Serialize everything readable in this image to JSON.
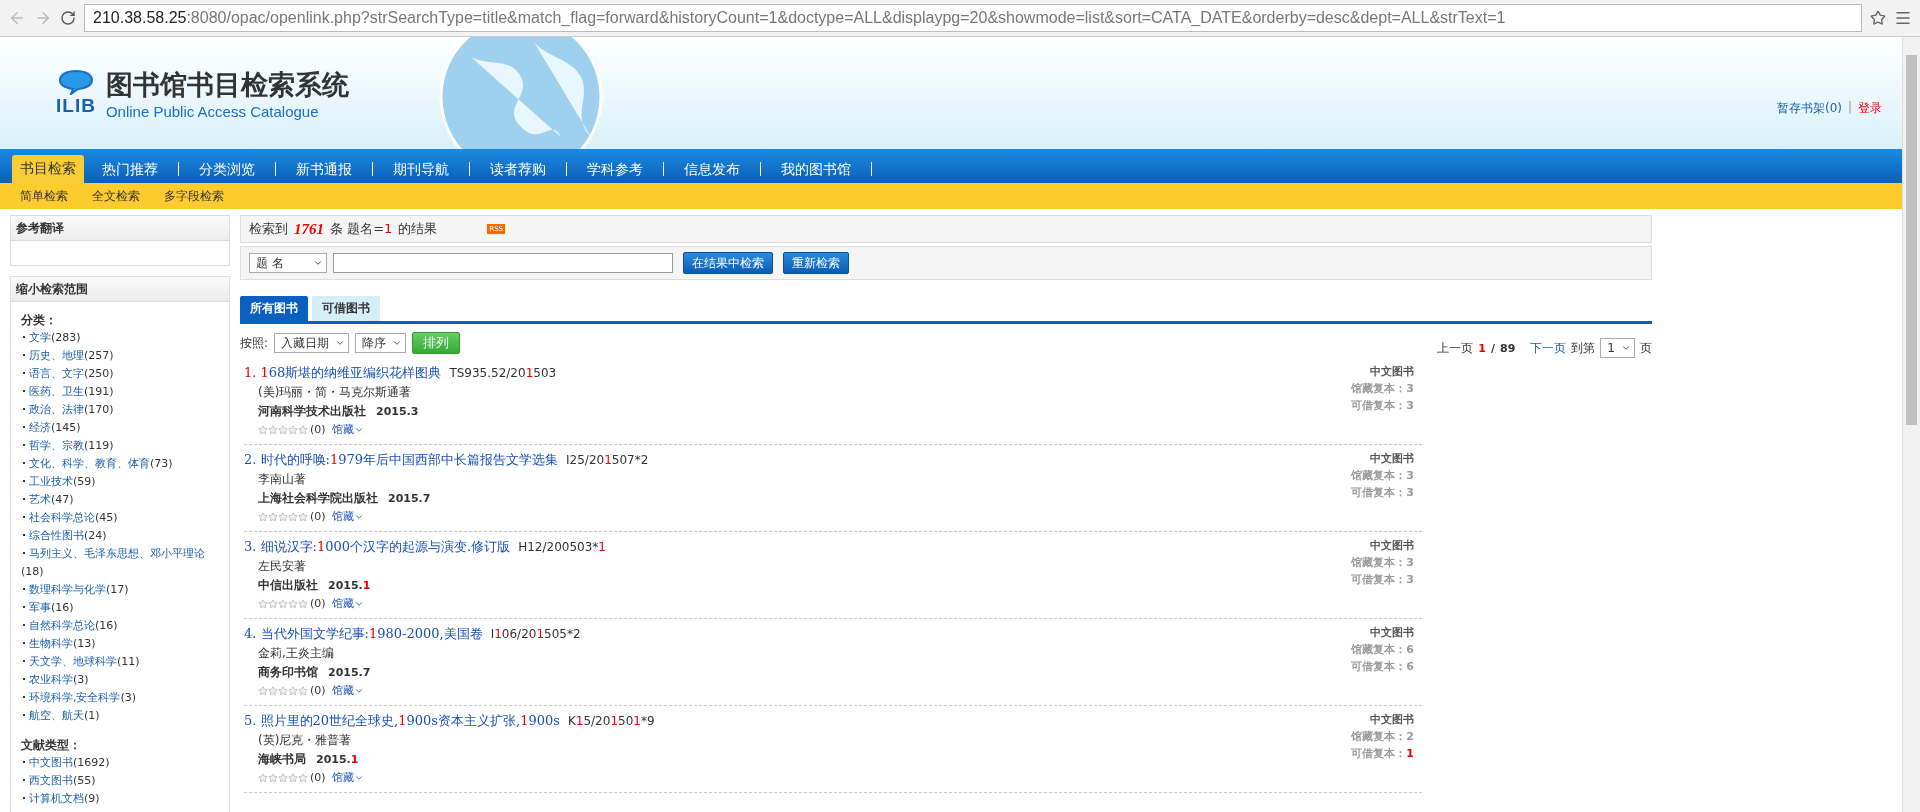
{
  "browser": {
    "url_host": "210.38.58.25",
    "url_path": ":8080/opac/openlink.php?strSearchType=title&match_flag=forward&historyCount=1&doctype=ALL&displaypg=20&showmode=list&sort=CATA_DATE&orderby=desc&dept=ALL&strText=1"
  },
  "header": {
    "logo_text": "ILIB",
    "title": "图书馆书目检索系统",
    "subtitle": "Online Public Access Catalogue",
    "shelf_link": "暂存书架(0)",
    "separator": "|",
    "login_link": "登录"
  },
  "nav": [
    {
      "label": "书目检索",
      "selected": true
    },
    {
      "label": "热门推荐",
      "selected": false
    },
    {
      "label": "分类浏览",
      "selected": false
    },
    {
      "label": "新书通报",
      "selected": false
    },
    {
      "label": "期刊导航",
      "selected": false
    },
    {
      "label": "读者荐购",
      "selected": false
    },
    {
      "label": "学科参考",
      "selected": false
    },
    {
      "label": "信息发布",
      "selected": false
    },
    {
      "label": "我的图书馆",
      "selected": false
    }
  ],
  "subnav": [
    "简单检索",
    "全文检索",
    "多字段检索"
  ],
  "sidebar": {
    "translate_title": "参考翻译",
    "refine_title": "缩小检索范围",
    "groups": [
      {
        "title": "分类：",
        "items": [
          {
            "label": "文学",
            "count": "(283)"
          },
          {
            "label": "历史、地理",
            "count": "(257)"
          },
          {
            "label": "语言、文字",
            "count": "(250)"
          },
          {
            "label": "医药、卫生",
            "count": "(191)"
          },
          {
            "label": "政治、法律",
            "count": "(170)"
          },
          {
            "label": "经济",
            "count": "(145)"
          },
          {
            "label": "哲学、宗教",
            "count": "(119)"
          },
          {
            "label": "文化、科学、教育、体育",
            "count": "(73)"
          },
          {
            "label": "工业技术",
            "count": "(59)"
          },
          {
            "label": "艺术",
            "count": "(47)"
          },
          {
            "label": "社会科学总论",
            "count": "(45)"
          },
          {
            "label": "综合性图书",
            "count": "(24)"
          },
          {
            "label": "马列主义、毛泽东思想、邓小平理论",
            "count": "(18)"
          },
          {
            "label": "数理科学与化学",
            "count": "(17)"
          },
          {
            "label": "军事",
            "count": "(16)"
          },
          {
            "label": "自然科学总论",
            "count": "(16)"
          },
          {
            "label": "生物科学",
            "count": "(13)"
          },
          {
            "label": "天文学、地球科学",
            "count": "(11)"
          },
          {
            "label": "农业科学",
            "count": "(3)"
          },
          {
            "label": "环境科学,安全科学",
            "count": "(3)"
          },
          {
            "label": "航空、航天",
            "count": "(1)"
          }
        ]
      },
      {
        "title": "文献类型：",
        "items": [
          {
            "label": "中文图书",
            "count": "(1692)"
          },
          {
            "label": "西文图书",
            "count": "(55)"
          },
          {
            "label": "计算机文档",
            "count": "(9)"
          }
        ]
      }
    ]
  },
  "summary": {
    "prefix": "检索到",
    "count": "1761",
    "middle": "条 题名=",
    "term": "1",
    "suffix": "的结果",
    "rss": "RSS"
  },
  "search": {
    "field": "题 名",
    "buttons": [
      "在结果中检索",
      "重新检索"
    ]
  },
  "tabs": [
    {
      "label": "所有图书",
      "selected": true
    },
    {
      "label": "可借图书",
      "selected": false
    }
  ],
  "sort": {
    "label": "按照:",
    "field": "入藏日期",
    "order": "降序",
    "button": "排列"
  },
  "pager": {
    "prev": "上一页",
    "current": "1",
    "slash": "/",
    "total": "89",
    "next": "下一页",
    "goto": "到第",
    "page": "1",
    "unit": "页"
  },
  "results": [
    {
      "index": [
        {
          "text": "1.",
          "highlighted": true
        }
      ],
      "title": [
        {
          "text": "1",
          "highlighted": true
        },
        {
          "text": "68斯堪的纳维亚编织花样图典",
          "highlighted": false
        }
      ],
      "call": [
        {
          "text": "TS935.52/20",
          "highlighted": false
        },
        {
          "text": "1",
          "highlighted": true
        },
        {
          "text": "503",
          "highlighted": false
        }
      ],
      "author": "(美)玛丽・简・马克尔斯通著",
      "publisher": "河南科学技术出版社",
      "date": [
        {
          "text": "2015.3",
          "highlighted": false
        }
      ],
      "stars": 0,
      "rating": "(0)",
      "holdings": "馆藏",
      "type": "中文图书",
      "held_label": "馆藏复本：",
      "held": "3",
      "avail_label": "可借复本：",
      "avail": {
        "text": "3",
        "highlighted": false
      }
    },
    {
      "index": [
        {
          "text": "2.",
          "highlighted": false
        }
      ],
      "title": [
        {
          "text": "时代的呼唤:",
          "highlighted": false
        },
        {
          "text": "1",
          "highlighted": true
        },
        {
          "text": "979年后中国西部中长篇报告文学选集",
          "highlighted": false
        }
      ],
      "call": [
        {
          "text": "I25/20",
          "highlighted": false
        },
        {
          "text": "1",
          "highlighted": true
        },
        {
          "text": "507*2",
          "highlighted": false
        }
      ],
      "author": "李南山著",
      "publisher": "上海社会科学院出版社",
      "date": [
        {
          "text": "2015.7",
          "highlighted": false
        }
      ],
      "stars": 0,
      "rating": "(0)",
      "holdings": "馆藏",
      "type": "中文图书",
      "held_label": "馆藏复本：",
      "held": "3",
      "avail_label": "可借复本：",
      "avail": {
        "text": "3",
        "highlighted": false
      }
    },
    {
      "index": [
        {
          "text": "3.",
          "highlighted": false
        }
      ],
      "title": [
        {
          "text": "细说汉字:",
          "highlighted": false
        },
        {
          "text": "1",
          "highlighted": true
        },
        {
          "text": "000个汉字的起源与演变.修订版",
          "highlighted": false
        }
      ],
      "call": [
        {
          "text": "H12/200503*",
          "highlighted": false
        },
        {
          "text": "1",
          "highlighted": true
        }
      ],
      "author": "左民安著",
      "publisher": "中信出版社",
      "date": [
        {
          "text": "2015.",
          "highlighted": false
        },
        {
          "text": "1",
          "highlighted": true
        }
      ],
      "stars": 0,
      "rating": "(0)",
      "holdings": "馆藏",
      "type": "中文图书",
      "held_label": "馆藏复本：",
      "held": "3",
      "avail_label": "可借复本：",
      "avail": {
        "text": "3",
        "highlighted": false
      }
    },
    {
      "index": [
        {
          "text": "4.",
          "highlighted": false
        }
      ],
      "title": [
        {
          "text": "当代外国文学纪事:",
          "highlighted": false
        },
        {
          "text": "1",
          "highlighted": true
        },
        {
          "text": "980-2000,美国卷",
          "highlighted": false
        }
      ],
      "call": [
        {
          "text": "I",
          "highlighted": false
        },
        {
          "text": "1",
          "highlighted": true
        },
        {
          "text": "06/20",
          "highlighted": false
        },
        {
          "text": "1",
          "highlighted": true
        },
        {
          "text": "505*2",
          "highlighted": false
        }
      ],
      "author": "金莉,王炎主编",
      "publisher": "商务印书馆",
      "date": [
        {
          "text": "2015.7",
          "highlighted": false
        }
      ],
      "stars": 0,
      "rating": "(0)",
      "holdings": "馆藏",
      "type": "中文图书",
      "held_label": "馆藏复本：",
      "held": "6",
      "avail_label": "可借复本：",
      "avail": {
        "text": "6",
        "highlighted": false
      }
    },
    {
      "index": [
        {
          "text": "5.",
          "highlighted": false
        }
      ],
      "title": [
        {
          "text": "照片里的20世纪全球史,",
          "highlighted": false
        },
        {
          "text": "1",
          "highlighted": true
        },
        {
          "text": "900s资本主义扩张,",
          "highlighted": false
        },
        {
          "text": "1",
          "highlighted": true
        },
        {
          "text": "900s",
          "highlighted": false
        }
      ],
      "call": [
        {
          "text": "K",
          "highlighted": false
        },
        {
          "text": "1",
          "highlighted": true
        },
        {
          "text": "5/20",
          "highlighted": false
        },
        {
          "text": "1",
          "highlighted": true
        },
        {
          "text": "50",
          "highlighted": false
        },
        {
          "text": "1",
          "highlighted": true
        },
        {
          "text": "*9",
          "highlighted": false
        }
      ],
      "author": "(英)尼克・雅普著",
      "publisher": "海峡书局",
      "date": [
        {
          "text": "2015.",
          "highlighted": false
        },
        {
          "text": "1",
          "highlighted": true
        }
      ],
      "stars": 0,
      "rating": "(0)",
      "holdings": "馆藏",
      "type": "中文图书",
      "held_label": "馆藏复本：",
      "held": "2",
      "avail_label": "可借复本：",
      "avail": {
        "text": "1",
        "highlighted": true
      }
    }
  ]
}
